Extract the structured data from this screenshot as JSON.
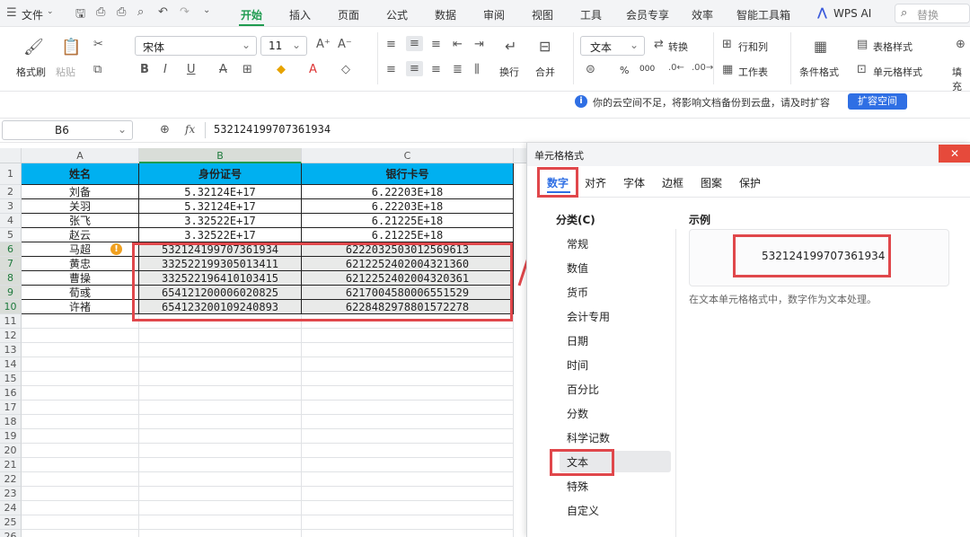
{
  "menubar": {
    "file": "文件",
    "tabs": [
      "开始",
      "插入",
      "页面",
      "公式",
      "数据",
      "审阅",
      "视图",
      "工具",
      "会员专享",
      "效率",
      "智能工具箱"
    ],
    "wps_ai": "WPS AI",
    "search_placeholder": "替换"
  },
  "ribbon": {
    "format_painter": "格式刷",
    "paste": "粘贴",
    "font_name": "宋体",
    "font_size": "11",
    "number_format": "文本",
    "convert": "转换",
    "rows_cols": "行和列",
    "worksheet": "工作表",
    "wrap": "换行",
    "merge": "合并",
    "conditional_format": "条件格式",
    "table_style": "表格样式",
    "cell_style": "单元格样式",
    "fill": "填充",
    "percent": "%",
    "thousands": "000"
  },
  "notice": {
    "text": "你的云空间不足，将影响文档备份到云盘，请及时扩容",
    "button": "扩容空间"
  },
  "formula_bar": {
    "cell_ref": "B6",
    "fx": "fx",
    "value": "532124199707361934"
  },
  "sheet": {
    "columns": [
      "A",
      "B",
      "C"
    ],
    "header": [
      "姓名",
      "身份证号",
      "银行卡号"
    ],
    "rows": [
      [
        "刘备",
        "5.32124E+17",
        "6.22203E+18"
      ],
      [
        "关羽",
        "5.32124E+17",
        "6.22203E+18"
      ],
      [
        "张飞",
        "3.32522E+17",
        "6.21225E+18"
      ],
      [
        "赵云",
        "3.32522E+17",
        "6.21225E+18"
      ],
      [
        "马超",
        "532124199707361934",
        "6222032503012569613"
      ],
      [
        "黄忠",
        "332522199305013411",
        "6212252402004321360"
      ],
      [
        "曹操",
        "332522196410103415",
        "6212252402004320361"
      ],
      [
        "荀彧",
        "654121200006020825",
        "6217004580006551529"
      ],
      [
        "许褚",
        "654123200109240893",
        "6228482978801572278"
      ]
    ],
    "row_numbers": [
      "1",
      "2",
      "3",
      "4",
      "5",
      "6",
      "7",
      "8",
      "9",
      "10",
      "11",
      "12",
      "13",
      "14",
      "15",
      "16",
      "17",
      "18",
      "19",
      "20",
      "21",
      "22",
      "23",
      "24",
      "25",
      "26"
    ],
    "header_color": "#00b0f0"
  },
  "dialog": {
    "title": "单元格格式",
    "tabs": [
      "数字",
      "对齐",
      "字体",
      "边框",
      "图案",
      "保护"
    ],
    "category_label": "分类(C)",
    "categories": [
      "常规",
      "数值",
      "货币",
      "会计专用",
      "日期",
      "时间",
      "百分比",
      "分数",
      "科学记数",
      "文本",
      "特殊",
      "自定义"
    ],
    "sample_label": "示例",
    "sample_value": "532124199707361934",
    "description": "在文本单元格格式中，数字作为文本处理。"
  },
  "colors": {
    "accent": "#1e9b4f",
    "highlight": "#e0474b"
  }
}
